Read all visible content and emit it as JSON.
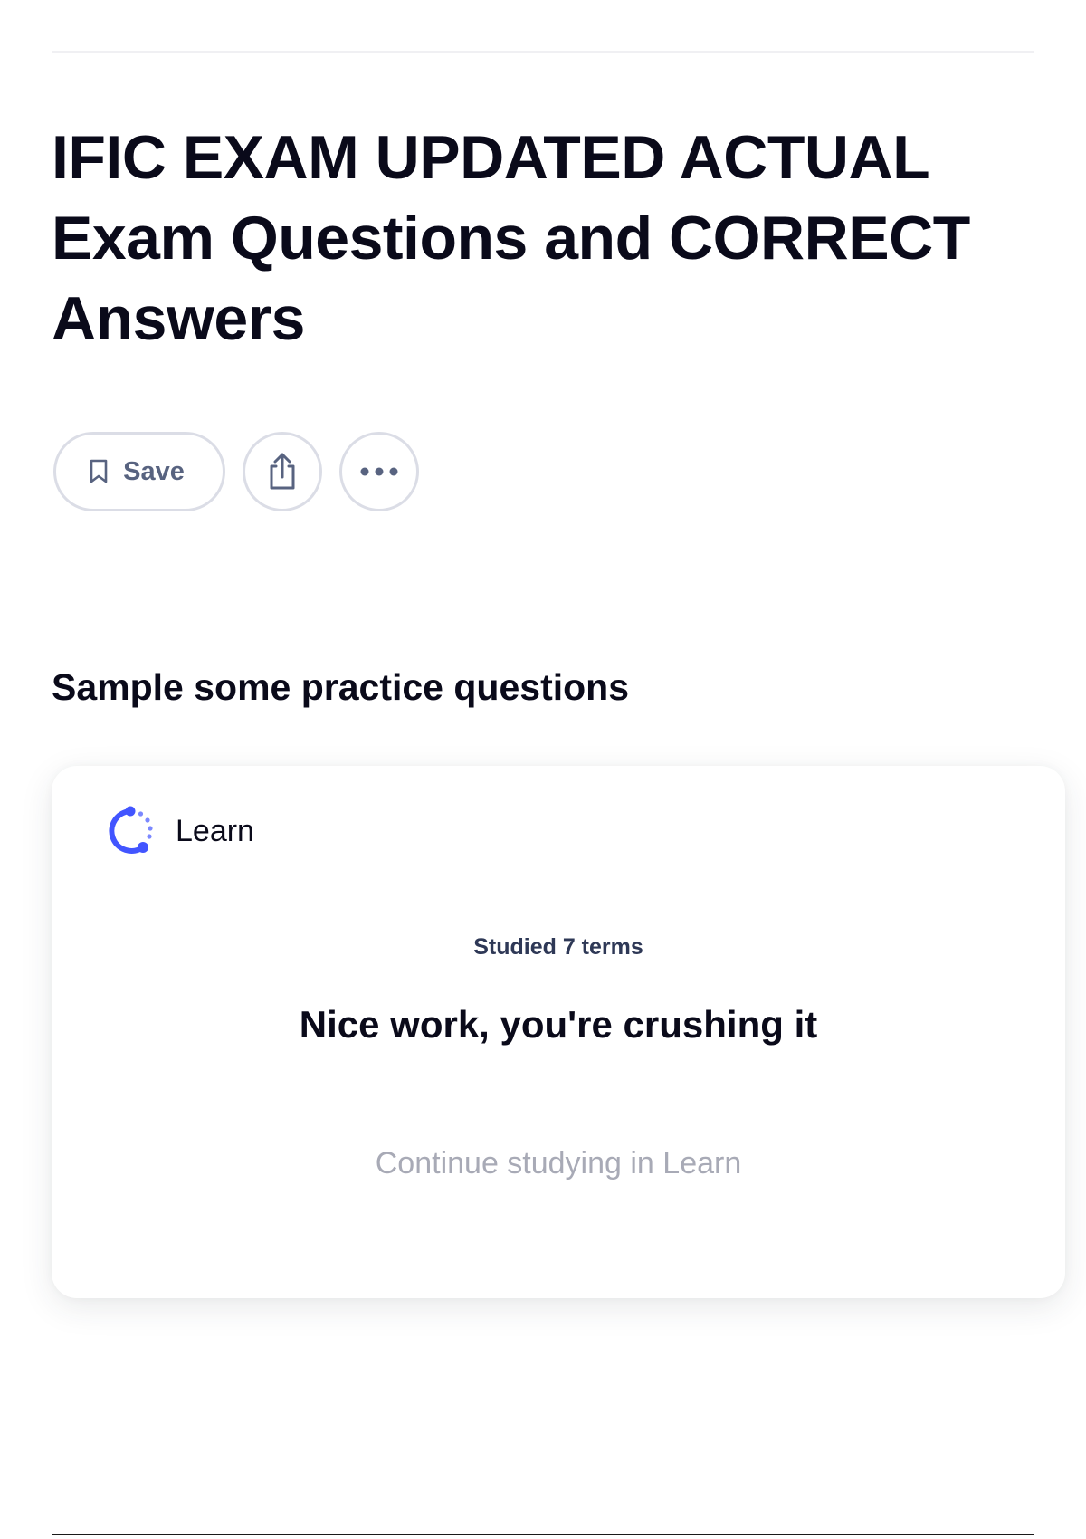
{
  "page": {
    "title": "IFIC EXAM UPDATED ACTUAL Exam Questions and CORRECT Answers"
  },
  "actions": {
    "save_label": "Save",
    "save_icon": "bookmark-icon",
    "share_icon": "share-icon",
    "more_icon": "more-options-icon"
  },
  "practice": {
    "heading": "Sample some practice questions",
    "card": {
      "title": "Learn",
      "icon": "learn-progress-icon",
      "studied_text": "Studied 7 terms",
      "message": "Nice work, you're crushing it",
      "continue_label": "Continue studying in Learn"
    }
  },
  "colors": {
    "accent": "#4255ff",
    "text_primary": "#0a0a1a",
    "text_secondary": "#586380",
    "muted": "#a8aab6"
  }
}
